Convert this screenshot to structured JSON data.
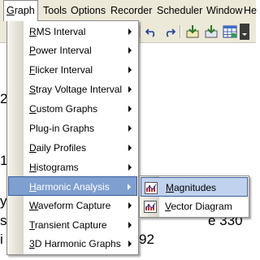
{
  "menubar": {
    "items": [
      {
        "label": "Graph",
        "mnemonic": "G",
        "rest": "raph"
      },
      {
        "label": "Tools"
      },
      {
        "label": "Options"
      },
      {
        "label": "Recorder"
      },
      {
        "label": "Scheduler"
      },
      {
        "label": "Window"
      },
      {
        "label": "He"
      }
    ]
  },
  "toolbar": {
    "icons": [
      "undo-icon",
      "redo-icon",
      "download-icon",
      "download-all-icon",
      "table-icon",
      "dropdown-icon"
    ]
  },
  "background_text": {
    "line_a": "e 330",
    "line_b": "92"
  },
  "graph_menu": {
    "items": [
      {
        "m": "R",
        "rest": "MS Interval",
        "submenu": true
      },
      {
        "m": "P",
        "rest": "ower Interval",
        "submenu": true
      },
      {
        "m": "F",
        "rest": "licker Interval",
        "submenu": true
      },
      {
        "m": "S",
        "rest": "tray Voltage Interval",
        "submenu": true
      },
      {
        "m": "C",
        "rest": "ustom Graphs",
        "submenu": true
      },
      {
        "pre": "Plu",
        "m": "g",
        "rest": "-in Graphs",
        "submenu": true
      },
      {
        "m": "D",
        "rest": "aily Profiles",
        "submenu": true
      },
      {
        "m": "H",
        "rest": "istograms",
        "submenu": true
      },
      {
        "m": "H",
        "rest": "armonic Analysis",
        "submenu": true,
        "highlighted": true
      },
      {
        "m": "W",
        "rest": "aveform Capture",
        "submenu": true
      },
      {
        "m": "T",
        "rest": "ransient Capture",
        "submenu": true
      },
      {
        "m": "3",
        "rest": "D Harmonic Graphs",
        "submenu": true
      }
    ]
  },
  "harmonic_submenu": {
    "items": [
      {
        "m": "M",
        "rest": "agnitudes",
        "icon": "bar-graph-icon",
        "highlighted": true
      },
      {
        "m": "V",
        "rest": "ector Diagram",
        "icon": "bar-graph-icon"
      }
    ]
  },
  "colors": {
    "highlight": "#7e9fcf",
    "submenu_highlight": "#c1d2ee",
    "menubar": "#ece9d8"
  }
}
